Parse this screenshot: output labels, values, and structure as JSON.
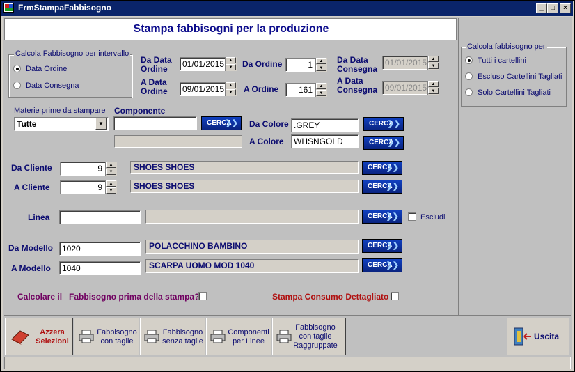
{
  "window": {
    "title": "FrmStampaFabbisogno",
    "min": "_",
    "max": "□",
    "close": "×"
  },
  "header": {
    "title": "Stampa fabbisogni per la produzione"
  },
  "interval": {
    "group_title": "Calcola Fabbisogno per intervallo",
    "radio_ordine": "Data Ordine",
    "radio_consegna": "Data Consegna",
    "selected": "Data Ordine"
  },
  "dates": {
    "da_data_ordine_label": "Da Data\nOrdine",
    "da_data_ordine_value": "01/01/2015",
    "a_data_ordine_label": "A Data\nOrdine",
    "a_data_ordine_value": "09/01/2015",
    "da_ordine_label": "Da Ordine",
    "da_ordine_value": "1",
    "a_ordine_label": "A Ordine",
    "a_ordine_value": "161",
    "da_data_consegna_label": "Da Data\nConsegna",
    "da_data_consegna_value": "01/01/2015",
    "a_data_consegna_label": "A Data\nConsegna",
    "a_data_consegna_value": "09/01/2015"
  },
  "calc_panel": {
    "group_title": "Calcola fabbisogno per",
    "options": [
      "Tutti i cartellini",
      "Escluso Cartellini Tagliati",
      "Solo Cartellini Tagliati"
    ],
    "selected": "Tutti i cartellini"
  },
  "materie": {
    "label": "Materie prime da stampare",
    "value": "Tutte"
  },
  "componente": {
    "label": "Componente",
    "value": "",
    "description": ""
  },
  "colore": {
    "da_label": "Da Colore",
    "da_value": ".GREY",
    "a_label": "A Colore",
    "a_value": "WHSNGOLD"
  },
  "cliente": {
    "da_label": "Da Cliente",
    "da_value": "9",
    "da_desc": "SHOES  SHOES",
    "a_label": "A Cliente",
    "a_value": "9",
    "a_desc": "SHOES  SHOES"
  },
  "linea": {
    "label": "Linea",
    "value": "",
    "desc": "",
    "escludi_label": "Escludi"
  },
  "modello": {
    "da_label": "Da Modello",
    "da_value": "1020",
    "da_desc": "POLACCHINO BAMBINO",
    "a_label": "A Modello",
    "a_value": "1040",
    "a_desc": "SCARPA UOMO MOD 1040"
  },
  "cerca_label": "CERCA",
  "options": {
    "calcolare_label": "Calcolare il   Fabbisogno prima della stampa?",
    "consumo_label": "Stampa Consumo Dettagliato"
  },
  "toolbar": {
    "azzera": "Azzera\nSelezioni",
    "con_taglie": "Fabbisogno\ncon taglie",
    "senza_taglie": "Fabbisogno\nsenza taglie",
    "componenti": "Componenti\nper Linee",
    "raggruppate": "Fabbisogno\ncon taglie\nRaggruppate",
    "uscita": "Uscita"
  },
  "colors": {
    "title_bg": "#0a246a",
    "label_blue": "#0c0c70",
    "label_red": "#b01010",
    "label_purple": "#700060",
    "cerca_bg": "#0a2480"
  }
}
